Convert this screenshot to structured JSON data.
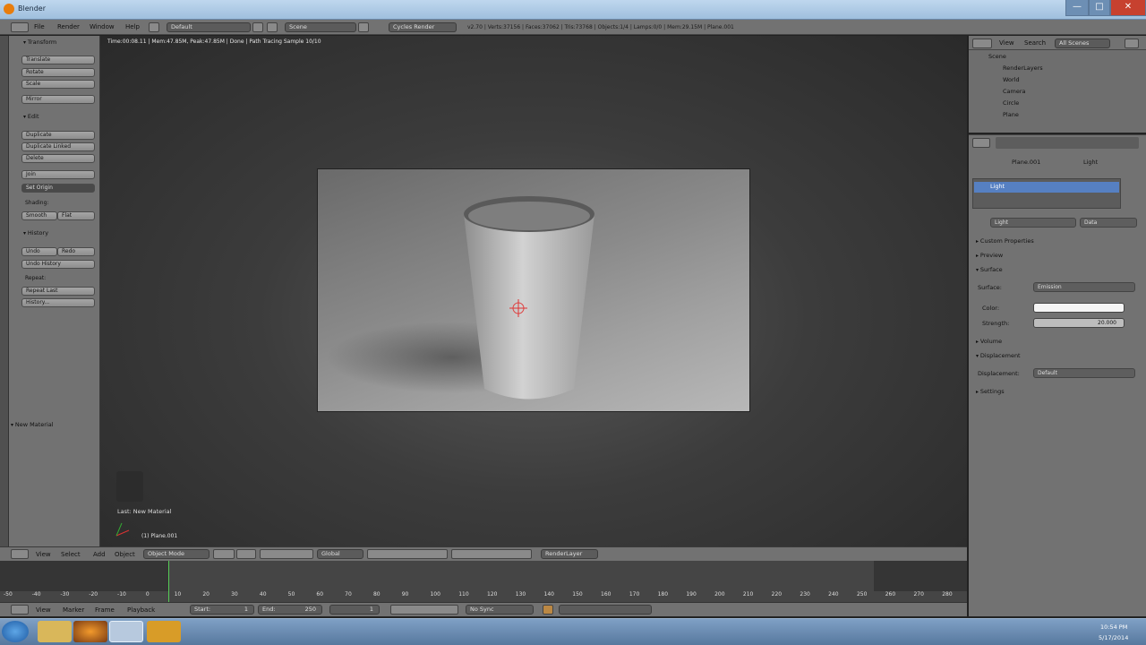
{
  "window": {
    "title": "Blender",
    "minimize": "—",
    "maximize": "□",
    "close": "✕"
  },
  "info_header": {
    "menus": [
      "File",
      "Render",
      "Window",
      "Help"
    ],
    "layout": "Default",
    "scene": "Scene",
    "engine": "Cycles Render",
    "stats": "v2.70 | Verts:37156 | Faces:37062 | Tris:73768 | Objects:1/4 | Lamps:0/0 | Mem:29.15M | Plane.001"
  },
  "viewport": {
    "render_status": "Time:00:08.11 | Mem:47.85M, Peak:47.85M | Done | Path Tracing Sample 10/10",
    "last_op": "Last: New Material",
    "object_label": "(1) Plane.001"
  },
  "tool_shelf": {
    "transform_header": "Transform",
    "transform_buttons": [
      "Translate",
      "Rotate",
      "Scale"
    ],
    "mirror": "Mirror",
    "edit_header": "Edit",
    "edit_buttons": [
      "Duplicate",
      "Duplicate Linked",
      "Delete"
    ],
    "join": "Join",
    "set_origin": "Set Origin",
    "shading_label": "Shading:",
    "smooth": "Smooth",
    "flat": "Flat",
    "history_header": "History",
    "undo": "Undo",
    "redo": "Redo",
    "undo_history": "Undo History",
    "repeat_label": "Repeat:",
    "repeat_last": "Repeat Last",
    "history": "History...",
    "new_material": "New Material"
  },
  "view3d_header": {
    "menus": [
      "View",
      "Select",
      "Add",
      "Object"
    ],
    "mode": "Object Mode",
    "pivot": "Global",
    "render_layer": "RenderLayer"
  },
  "timeline": {
    "ticks": [
      "-50",
      "-40",
      "-30",
      "-20",
      "-10",
      "0",
      "10",
      "20",
      "30",
      "40",
      "50",
      "60",
      "70",
      "80",
      "90",
      "100",
      "110",
      "120",
      "130",
      "140",
      "150",
      "160",
      "170",
      "180",
      "190",
      "200",
      "210",
      "220",
      "230",
      "240",
      "250",
      "260",
      "270",
      "280"
    ],
    "menus": [
      "View",
      "Marker",
      "Frame",
      "Playback"
    ],
    "start": "Start:",
    "start_val": "1",
    "end": "End:",
    "end_val": "250",
    "current": "1",
    "sync": "No Sync"
  },
  "outliner": {
    "menus": [
      "View",
      "Search"
    ],
    "filter": "All Scenes",
    "rows": [
      "Scene",
      "RenderLayers",
      "World",
      "Camera",
      "Circle",
      "Plane"
    ]
  },
  "properties": {
    "breadcrumb": [
      "Plane.001",
      "Light"
    ],
    "material_slot": "Light",
    "material_name": "Light",
    "data_mode": "Data",
    "sections": [
      "Custom Properties",
      "Preview",
      "Surface"
    ],
    "surface_label": "Surface:",
    "surface_value": "Emission",
    "color_label": "Color:",
    "strength_label": "Strength:",
    "strength_value": "20.000",
    "volume": "Volume",
    "displacement": "Displacement",
    "displacement_label": "Displacement:",
    "displacement_value": "Default",
    "settings": "Settings",
    "color_hex": "#f4f4f4"
  },
  "taskbar": {
    "time": "10:54 PM",
    "date": "5/17/2014"
  }
}
